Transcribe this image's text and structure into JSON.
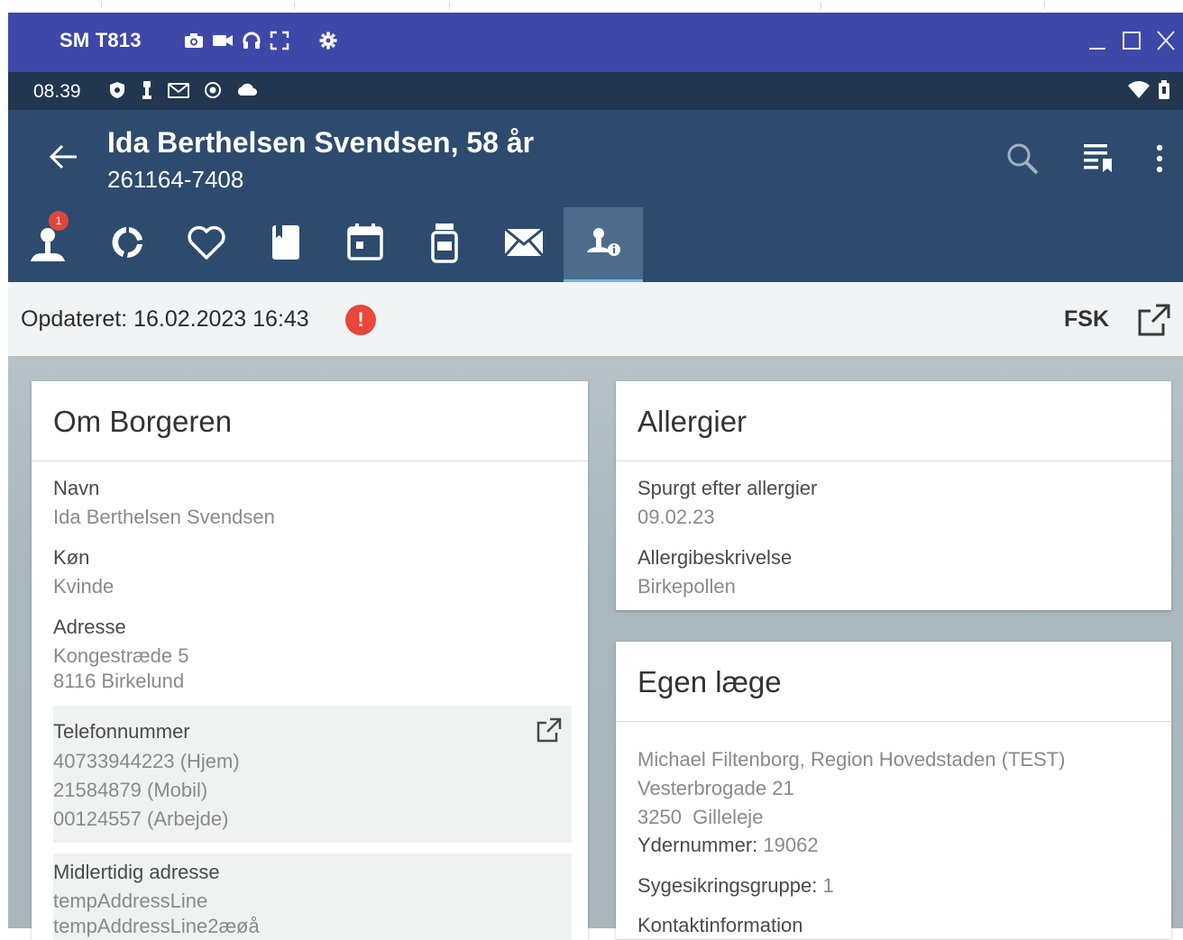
{
  "emulator": {
    "device_name": "SM T813",
    "toolbar_icons": [
      "camera-icon",
      "video-icon",
      "headset-icon",
      "fullscreen-icon",
      "settings-icon"
    ],
    "window_controls": [
      "minimize",
      "maximize",
      "close"
    ]
  },
  "status_bar": {
    "time": "08.39",
    "icons": [
      "shield-icon",
      "usb-icon",
      "gmail-icon",
      "record-icon",
      "cloud-icon"
    ],
    "right_icons": [
      "wifi-icon",
      "battery-icon"
    ]
  },
  "header": {
    "patient_name": "Ida Berthelsen Svendsen, 58 år",
    "patient_id": "261164-7408",
    "actions": [
      "search-icon",
      "bookmark-list-icon",
      "more-vert-icon"
    ]
  },
  "tabs": [
    {
      "icon": "person-alert-icon",
      "badge": "1",
      "active": false
    },
    {
      "icon": "cycle-icon",
      "active": false
    },
    {
      "icon": "heart-icon",
      "active": false
    },
    {
      "icon": "journal-icon",
      "active": false
    },
    {
      "icon": "calendar-icon",
      "active": false
    },
    {
      "icon": "medicine-bottle-icon",
      "active": false
    },
    {
      "icon": "mail-icon",
      "active": false
    },
    {
      "icon": "person-info-icon",
      "active": true
    }
  ],
  "update_bar": {
    "text": "Opdateret: 16.02.2023 16:43",
    "alert": "!",
    "fsk_label": "FSK"
  },
  "om_borgeren": {
    "title": "Om Borgeren",
    "navn_label": "Navn",
    "navn_value": "Ida Berthelsen Svendsen",
    "kon_label": "Køn",
    "kon_value": "Kvinde",
    "adresse_label": "Adresse",
    "adresse_line1": "Kongestræde 5",
    "adresse_line2": "8116 Birkelund",
    "telefon_label": "Telefonnummer",
    "telefon_1": "40733944223 (Hjem)",
    "telefon_2": "21584879 (Mobil)",
    "telefon_3": "00124557 (Arbejde)",
    "midl_label": "Midlertidig adresse",
    "midl_line1": "tempAddressLine",
    "midl_line2": "tempAddressLine2æøå"
  },
  "allergier": {
    "title": "Allergier",
    "spurgt_label": "Spurgt efter allergier",
    "spurgt_value": "09.02.23",
    "beskrivelse_label": "Allergibeskrivelse",
    "beskrivelse_value": "Birkepollen"
  },
  "egen_laege": {
    "title": "Egen læge",
    "line1": "Michael Filtenborg, Region Hovedstaden (TEST)",
    "line2": "Vesterbrogade 21",
    "line3": "3250  Gilleleje",
    "ydernummer_label": "Ydernummer:",
    "ydernummer_value": "19062",
    "sygesikring_label": "Sygesikringsgruppe:",
    "sygesikring_value": "1",
    "kontakt_label": "Kontaktinformation"
  }
}
